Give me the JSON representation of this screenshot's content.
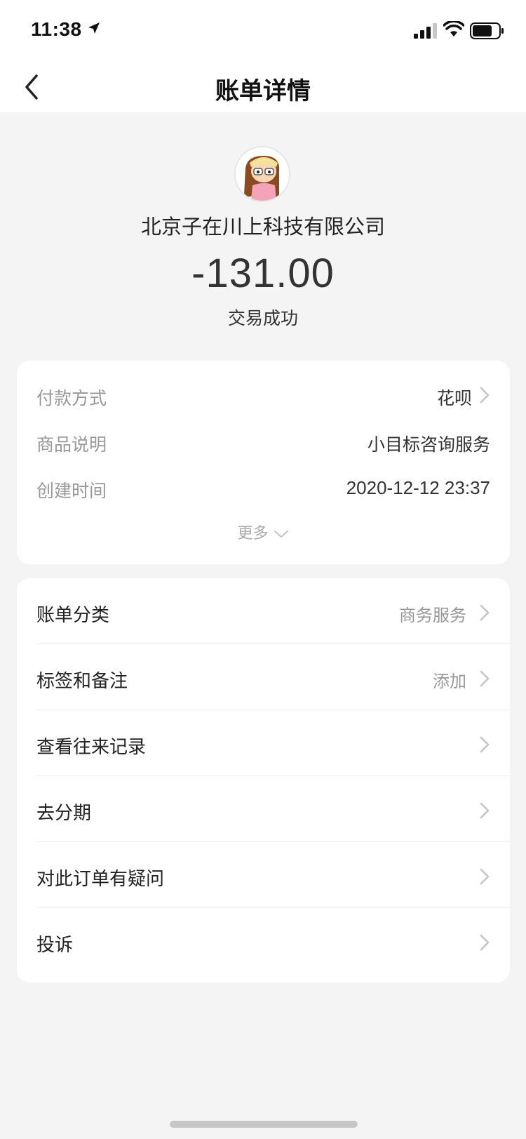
{
  "status_bar": {
    "time": "11:38"
  },
  "nav": {
    "title": "账单详情"
  },
  "summary": {
    "merchant": "北京子在川上科技有限公司",
    "amount": "-131.00",
    "status": "交易成功"
  },
  "details": {
    "payment_method": {
      "label": "付款方式",
      "value": "花呗"
    },
    "description": {
      "label": "商品说明",
      "value": "小目标咨询服务"
    },
    "created_time": {
      "label": "创建时间",
      "value": "2020-12-12 23:37"
    },
    "more_label": "更多"
  },
  "menu": [
    {
      "label": "账单分类",
      "hint": "商务服务"
    },
    {
      "label": "标签和备注",
      "hint": "添加"
    },
    {
      "label": "查看往来记录",
      "hint": ""
    },
    {
      "label": "去分期",
      "hint": ""
    },
    {
      "label": "对此订单有疑问",
      "hint": ""
    },
    {
      "label": "投诉",
      "hint": ""
    }
  ],
  "colors": {
    "background": "#f4f4f4",
    "card": "#ffffff",
    "secondary_text": "#999999"
  }
}
